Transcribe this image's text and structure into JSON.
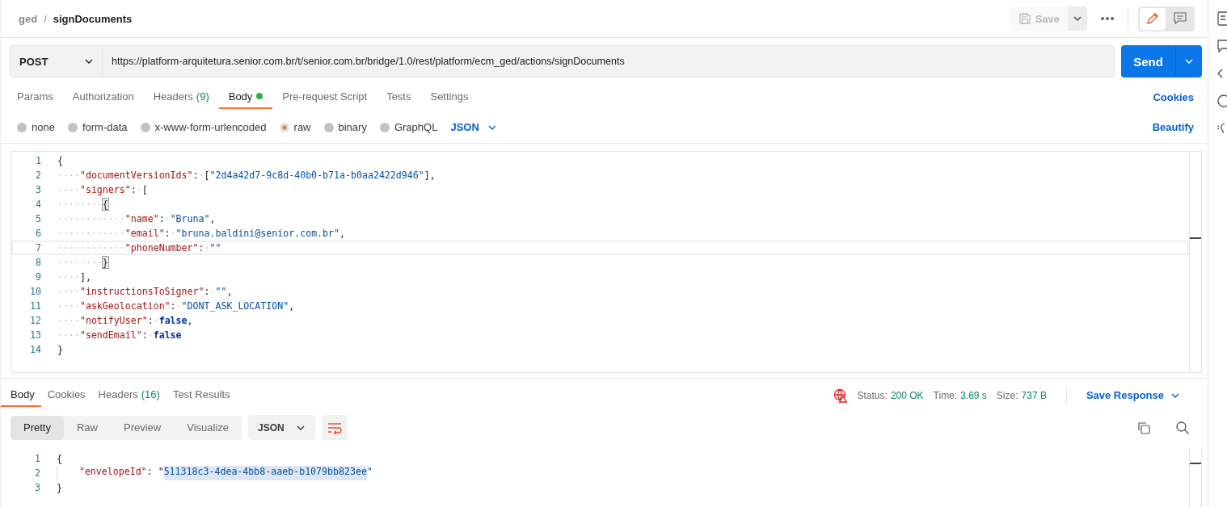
{
  "header": {
    "breadcrumb": [
      {
        "kind": "parent",
        "text": "ged"
      },
      {
        "kind": "sep",
        "text": "/"
      },
      {
        "kind": "current",
        "text": "signDocuments"
      }
    ],
    "save": {
      "label": "Save",
      "disabled": true
    },
    "modes": [
      {
        "kind": "edit",
        "selected": true
      },
      {
        "kind": "comments",
        "selected": false
      }
    ]
  },
  "request": {
    "method": "POST",
    "url": "https://platform-arquitetura.senior.com.br/t/senior.com.br/bridge/1.0/rest/platform/ecm_ged/actions/signDocuments",
    "send": "Send"
  },
  "tabs": [
    {
      "label": "Params",
      "selected": false
    },
    {
      "label": "Authorization",
      "selected": false
    },
    {
      "label": "Headers",
      "count": "(9)",
      "selected": false
    },
    {
      "label": "Body",
      "selected": true,
      "dot": true
    },
    {
      "label": "Pre-request Script",
      "selected": false
    },
    {
      "label": "Tests",
      "selected": false
    },
    {
      "label": "Settings",
      "selected": false
    }
  ],
  "cookies_link": "Cookies",
  "body_types": [
    {
      "label": "none",
      "selected": false
    },
    {
      "label": "form-data",
      "selected": false
    },
    {
      "label": "x-www-form-urlencoded",
      "selected": false
    },
    {
      "label": "raw",
      "selected": true
    },
    {
      "label": "binary",
      "selected": false
    },
    {
      "label": "GraphQL",
      "selected": false
    }
  ],
  "language": "JSON",
  "beautify": "Beautify",
  "editor": {
    "lines": [
      {
        "number": "1",
        "current": false,
        "segments": [
          {
            "kind": "punct",
            "text": "{"
          }
        ]
      },
      {
        "number": "2",
        "current": false,
        "segments": [
          {
            "kind": "space",
            "text": "····"
          },
          {
            "kind": "key",
            "text": "\"documentVersionIds\""
          },
          {
            "kind": "punct",
            "text": ":"
          },
          {
            "kind": "space",
            "text": "·"
          },
          {
            "kind": "punct",
            "text": "["
          },
          {
            "kind": "string",
            "text": "\"2d4a42d7-9c8d-40b0-b71a-b0aa2422d946\""
          },
          {
            "kind": "punct",
            "text": "],"
          }
        ]
      },
      {
        "number": "3",
        "current": false,
        "segments": [
          {
            "kind": "space",
            "text": "····"
          },
          {
            "kind": "key",
            "text": "\"signers\""
          },
          {
            "kind": "punct",
            "text": ":"
          },
          {
            "kind": "space",
            "text": "·"
          },
          {
            "kind": "punct",
            "text": "["
          }
        ]
      },
      {
        "number": "4",
        "current": false,
        "segments": [
          {
            "kind": "space",
            "text": "········"
          },
          {
            "kind": "punct",
            "text": "{",
            "matched": true
          }
        ]
      },
      {
        "number": "5",
        "current": false,
        "segments": [
          {
            "kind": "space",
            "text": "············"
          },
          {
            "kind": "key",
            "text": "\"name\""
          },
          {
            "kind": "punct",
            "text": ":"
          },
          {
            "kind": "space",
            "text": "·"
          },
          {
            "kind": "string",
            "text": "\"Bruna\""
          },
          {
            "kind": "punct",
            "text": ","
          }
        ]
      },
      {
        "number": "6",
        "current": false,
        "segments": [
          {
            "kind": "space",
            "text": "············"
          },
          {
            "kind": "key",
            "text": "\"email\""
          },
          {
            "kind": "punct",
            "text": ":"
          },
          {
            "kind": "space",
            "text": "·"
          },
          {
            "kind": "string",
            "text": "\"bruna.baldini@senior.com.br\""
          },
          {
            "kind": "punct",
            "text": ","
          }
        ]
      },
      {
        "number": "7",
        "current": true,
        "segments": [
          {
            "kind": "space",
            "text": "············"
          },
          {
            "kind": "key",
            "text": "\"phoneNumber\""
          },
          {
            "kind": "punct",
            "text": ":"
          },
          {
            "kind": "space",
            "text": "·"
          },
          {
            "kind": "string",
            "text": "\"\""
          }
        ]
      },
      {
        "number": "8",
        "current": false,
        "segments": [
          {
            "kind": "space",
            "text": "········"
          },
          {
            "kind": "punct",
            "text": "}",
            "matched": true
          }
        ]
      },
      {
        "number": "9",
        "current": false,
        "segments": [
          {
            "kind": "space",
            "text": "····"
          },
          {
            "kind": "punct",
            "text": "],"
          }
        ]
      },
      {
        "number": "10",
        "current": false,
        "segments": [
          {
            "kind": "space",
            "text": "····"
          },
          {
            "kind": "key",
            "text": "\"instructionsToSigner\""
          },
          {
            "kind": "punct",
            "text": ":"
          },
          {
            "kind": "space",
            "text": "·"
          },
          {
            "kind": "string",
            "text": "\"\""
          },
          {
            "kind": "punct",
            "text": ","
          }
        ]
      },
      {
        "number": "11",
        "current": false,
        "segments": [
          {
            "kind": "space",
            "text": "····"
          },
          {
            "kind": "key",
            "text": "\"askGeolocation\""
          },
          {
            "kind": "punct",
            "text": ":"
          },
          {
            "kind": "space",
            "text": "·"
          },
          {
            "kind": "string",
            "text": "\"DONT_ASK_LOCATION\""
          },
          {
            "kind": "punct",
            "text": ","
          }
        ]
      },
      {
        "number": "12",
        "current": false,
        "segments": [
          {
            "kind": "space",
            "text": "····"
          },
          {
            "kind": "key",
            "text": "\"notifyUser\""
          },
          {
            "kind": "punct",
            "text": ":"
          },
          {
            "kind": "space",
            "text": "·"
          },
          {
            "kind": "bool",
            "text": "false"
          },
          {
            "kind": "punct",
            "text": ","
          }
        ]
      },
      {
        "number": "13",
        "current": false,
        "segments": [
          {
            "kind": "space",
            "text": "····"
          },
          {
            "kind": "key",
            "text": "\"sendEmail\""
          },
          {
            "kind": "punct",
            "text": ":"
          },
          {
            "kind": "space",
            "text": "·"
          },
          {
            "kind": "bool",
            "text": "false"
          }
        ]
      },
      {
        "number": "14",
        "current": false,
        "segments": [
          {
            "kind": "punct",
            "text": "}"
          }
        ]
      }
    ]
  },
  "response_tabs": [
    {
      "label": "Body",
      "selected": true
    },
    {
      "label": "Cookies",
      "selected": false
    },
    {
      "label": "Headers",
      "count": "(16)",
      "selected": false
    },
    {
      "label": "Test Results",
      "selected": false
    }
  ],
  "status": {
    "status_label": "Status:",
    "status": "200 OK",
    "time_label": "Time:",
    "time": "3.69 s",
    "size_label": "Size:",
    "size": "737 B",
    "save_response": "Save Response"
  },
  "view_modes": [
    {
      "label": "Pretty",
      "selected": true
    },
    {
      "label": "Raw",
      "selected": false
    },
    {
      "label": "Preview",
      "selected": false
    },
    {
      "label": "Visualize",
      "selected": false
    }
  ],
  "response_format": "JSON",
  "response": {
    "lines": [
      {
        "number": "1",
        "segments": [
          {
            "kind": "punct",
            "text": "{"
          }
        ]
      },
      {
        "number": "2",
        "segments": [
          {
            "kind": "indent"
          },
          {
            "kind": "key",
            "text": "\"envelopeId\""
          },
          {
            "kind": "punct",
            "text": ": \""
          },
          {
            "kind": "string",
            "text": "511318c3-4dea-4bb8-aaeb-b1079bb823ee",
            "selected": true
          },
          {
            "kind": "string",
            "text": "\""
          }
        ]
      },
      {
        "number": "3",
        "segments": [
          {
            "kind": "punct",
            "text": "}"
          }
        ]
      }
    ]
  }
}
